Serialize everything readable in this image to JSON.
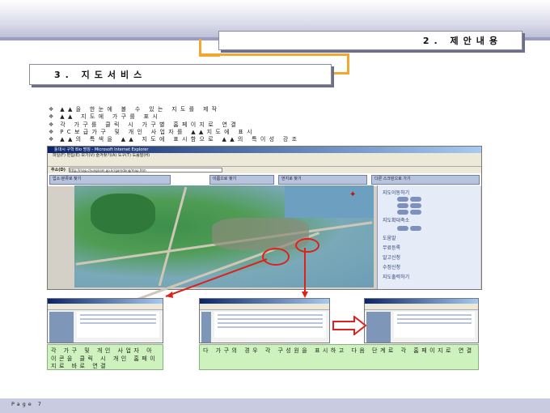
{
  "header": {
    "section_title": "2. 제안내용",
    "subsection_title": "3. 지도서비스"
  },
  "bullets": [
    "▲▲을 한눈에 볼 수 있는 지도를 제작",
    "▲▲ 지도에 가구를 표시",
    "각 가구를 클릭 시 가구별 홈페이지로 연결",
    "PC보급가구 및 개인 사업자를 ▲▲지도에 표시",
    "▲▲의 특색을 ▲▲ 지도에 표시함으로 ▲▲의 특이성 강조"
  ],
  "bullet_marker": "❖",
  "browser": {
    "title": "틀대시 구학 Blo 명칭 - Microsoft Internet Explorer",
    "menu": "파일(F)  편집(E)  보기(V)  즐겨찾기(A)  도구(T)  도움말(H)",
    "address_label": "주소(D)",
    "address_value": "http://map.chungnam.go.kr/gamdong/map.htm",
    "search_boxes": [
      "업소·분류로 찾기",
      "이름으로 찾기",
      "번지로 찾기",
      "다른 스크린으로 가기"
    ],
    "side_menu": [
      "지도이동하기",
      "지도확대축소",
      "도움말",
      "무료등록",
      "알고신청",
      "수정신청",
      "지도출력하기"
    ]
  },
  "captions": {
    "left": "각 가구 및 개인 사업자 아이콘을 클릭 시 개인 홈페이지로 바로 연결",
    "right": "다 가구의 경우 각 구성원을 표시하고 다음 단계로 각 홈페이지로 연결"
  },
  "footer": {
    "page_label": "Page 7"
  },
  "colors": {
    "accent_orange": "#f0a830",
    "highlight_red": "#e0201a",
    "caption_green": "#cdf2bd",
    "header_band": "#9a9cc4"
  }
}
